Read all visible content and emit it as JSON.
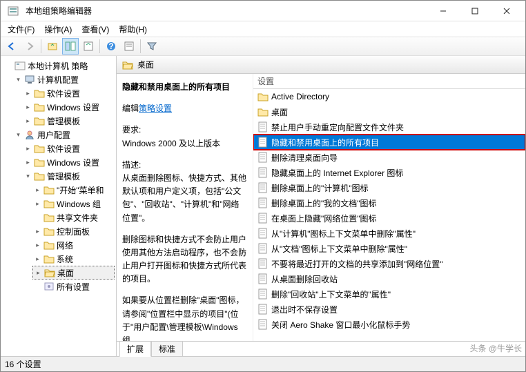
{
  "window": {
    "title": "本地组策略编辑器"
  },
  "menu": {
    "file": "文件(F)",
    "action": "操作(A)",
    "view": "查看(V)",
    "help": "帮助(H)"
  },
  "tree": {
    "root": "本地计算机 策略",
    "computer": "计算机配置",
    "user": "用户配置",
    "software": "软件设置",
    "windows": "Windows 设置",
    "admin": "管理模板",
    "startmenu": "\"开始\"菜单和",
    "wincomp": "Windows 组",
    "shared": "共享文件夹",
    "control": "控制面板",
    "network": "网络",
    "system": "系统",
    "desktop": "桌面",
    "allsettings": "所有设置"
  },
  "detail": {
    "header": "桌面",
    "title": "隐藏和禁用桌面上的所有项目",
    "edit": "编辑",
    "link": "策略设置",
    "req_label": "要求:",
    "req_value": "Windows 2000 及以上版本",
    "desc_label": "描述:",
    "desc1": "从桌面删除图标、快捷方式、其他默认项和用户定义项，包括\"公文包\"、\"回收站\"、\"计算机\"和\"网络位置\"。",
    "desc2": "删除图标和快捷方式不会防止用户使用其他方法启动程序，也不会防止用户打开图标和快捷方式所代表的项目。",
    "desc3": "如果要从位置栏删除\"桌面\"图标，请参阅\"位置栏中显示的项目\"(位于\"用户配置\\管理模板\\Windows 组"
  },
  "settings_header": "设置",
  "settings": [
    {
      "label": "Active Directory",
      "type": "folder"
    },
    {
      "label": "桌面",
      "type": "folder"
    },
    {
      "label": "禁止用户手动重定向配置文件文件夹",
      "type": "item"
    },
    {
      "label": "隐藏和禁用桌面上的所有项目",
      "type": "item",
      "selected": true,
      "highlighted": true
    },
    {
      "label": "删除清理桌面向导",
      "type": "item"
    },
    {
      "label": "隐藏桌面上的 Internet Explorer 图标",
      "type": "item"
    },
    {
      "label": "删除桌面上的\"计算机\"图标",
      "type": "item"
    },
    {
      "label": "删除桌面上的\"我的文档\"图标",
      "type": "item"
    },
    {
      "label": "在桌面上隐藏\"网络位置\"图标",
      "type": "item"
    },
    {
      "label": "从\"计算机\"图标上下文菜单中删除\"属性\"",
      "type": "item"
    },
    {
      "label": "从\"文档\"图标上下文菜单中删除\"属性\"",
      "type": "item"
    },
    {
      "label": "不要将最近打开的文档的共享添加到\"网络位置\"",
      "type": "item"
    },
    {
      "label": "从桌面删除回收站",
      "type": "item"
    },
    {
      "label": "删除\"回收站\"上下文菜单的\"属性\"",
      "type": "item"
    },
    {
      "label": "退出时不保存设置",
      "type": "item"
    },
    {
      "label": "关闭 Aero Shake 窗口最小化鼠标手势",
      "type": "item"
    }
  ],
  "tabs": {
    "extended": "扩展",
    "standard": "标准"
  },
  "status": "16 个设置",
  "watermark": "头条 @牛学长"
}
